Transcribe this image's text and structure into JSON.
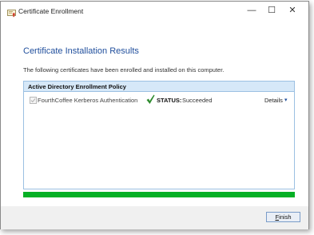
{
  "window": {
    "title": "Certificate Enrollment",
    "controls": {
      "minimize": "—",
      "maximize": "☐",
      "close": "✕"
    }
  },
  "page": {
    "heading": "Certificate Installation Results",
    "intro": "The following certificates have been enrolled and installed on this computer."
  },
  "policy_group": {
    "title": "Active Directory Enrollment Policy",
    "items": [
      {
        "name": "FourthCoffee Kerberos Authentication",
        "checked": true,
        "status_label": "STATUS:",
        "status_value": "Succeeded",
        "details_label": "Details",
        "details_icon": "chevron-down-icon"
      }
    ]
  },
  "progress": {
    "value": 1.0,
    "color": "#06b025"
  },
  "footer": {
    "finish_accesskey": "F",
    "finish_rest": "inish"
  },
  "colors": {
    "heading": "#1f4e9c",
    "group_header_bg": "#d6e8f8",
    "success_check": "#2e8b2e"
  }
}
